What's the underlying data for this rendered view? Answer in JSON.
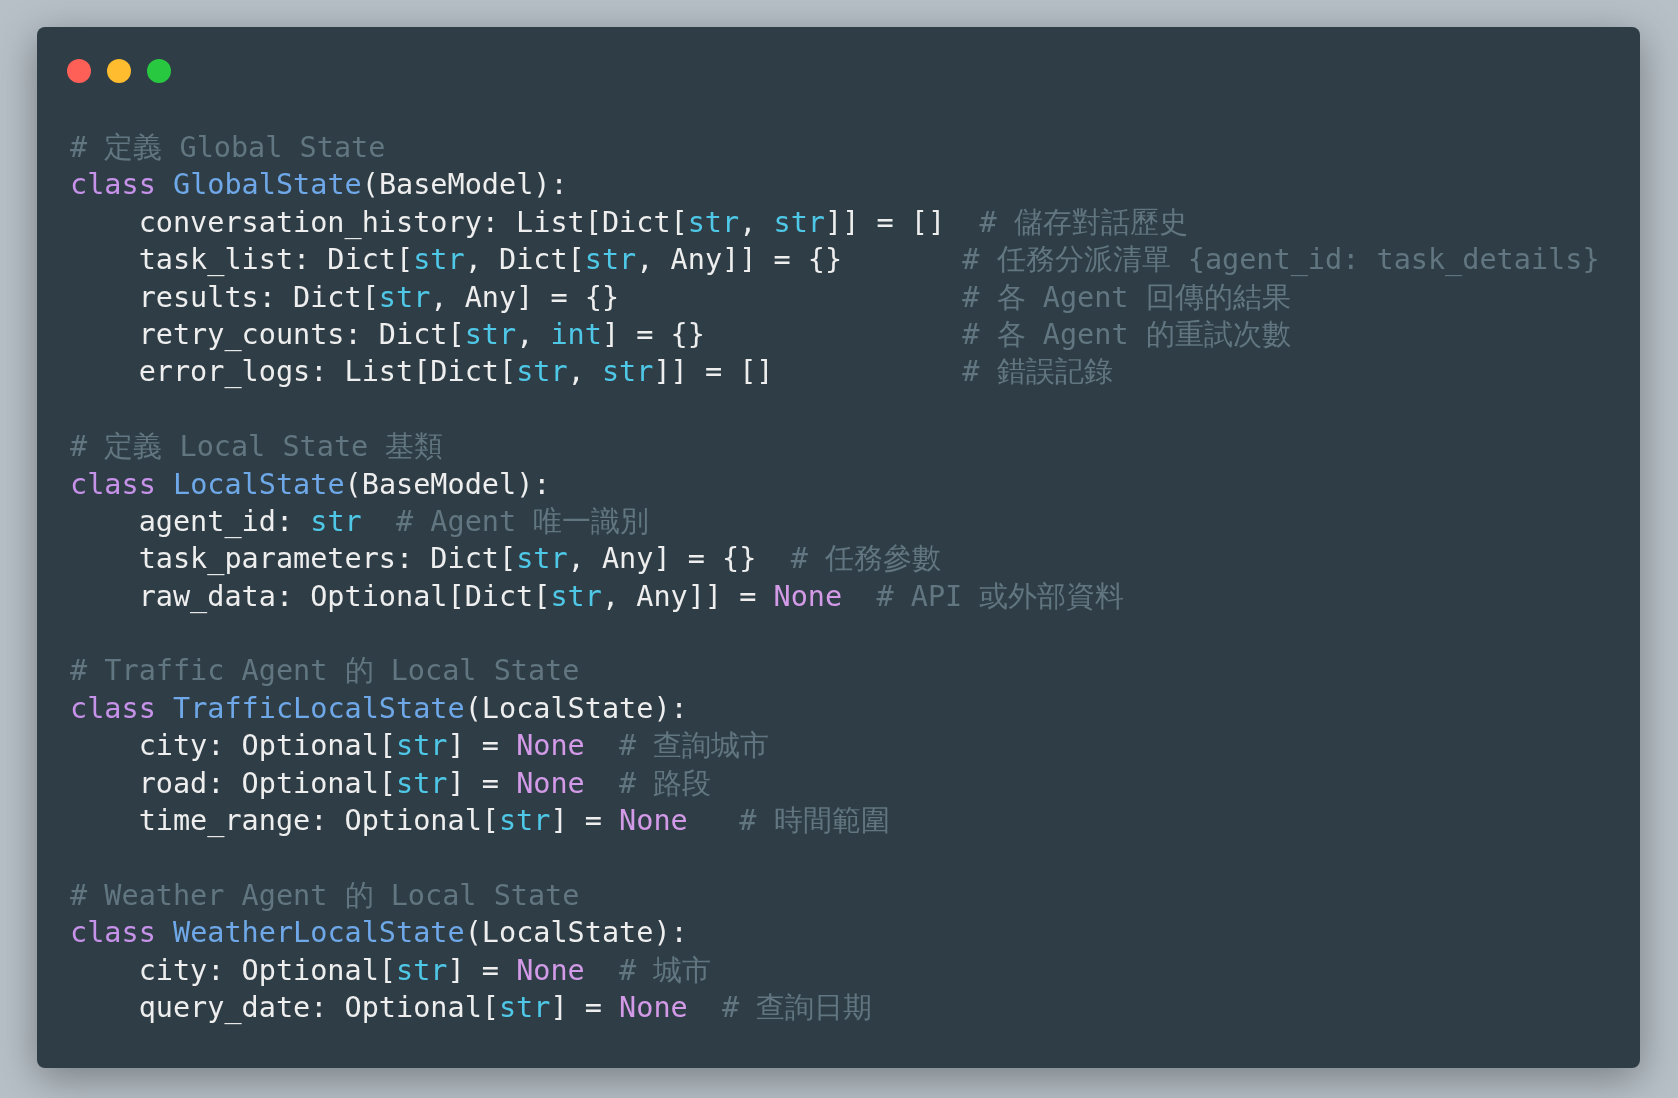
{
  "window": {
    "controls": [
      {
        "color": "#fe5f57"
      },
      {
        "color": "#febc2e"
      },
      {
        "color": "#28c840"
      }
    ]
  },
  "blocks": [
    {
      "comment": "# 定義 Global State",
      "header": [
        {
          "kind": "keyword",
          "text": "class"
        },
        {
          "kind": "classname",
          "text": " GlobalState"
        },
        {
          "kind": "plain",
          "text": "(BaseModel):"
        }
      ],
      "fields": [
        [
          {
            "kind": "plain",
            "text": "conversation_history: List[Dict["
          },
          {
            "kind": "type",
            "text": "str"
          },
          {
            "kind": "plain",
            "text": ", "
          },
          {
            "kind": "type",
            "text": "str"
          },
          {
            "kind": "plain",
            "text": "]] = []"
          },
          {
            "kind": "comment",
            "text": "  # 儲存對話歷史"
          }
        ],
        [
          {
            "kind": "plain",
            "text": "task_list: Dict["
          },
          {
            "kind": "type",
            "text": "str"
          },
          {
            "kind": "plain",
            "text": ", Dict["
          },
          {
            "kind": "type",
            "text": "str"
          },
          {
            "kind": "plain",
            "text": ", Any]] = {}"
          },
          {
            "kind": "comment",
            "text": "       # 任務分派清單 {agent_id: task_details}"
          }
        ],
        [
          {
            "kind": "plain",
            "text": "results: Dict["
          },
          {
            "kind": "type",
            "text": "str"
          },
          {
            "kind": "plain",
            "text": ", Any] = {}"
          },
          {
            "kind": "comment",
            "text": "                    # 各 Agent 回傳的結果"
          }
        ],
        [
          {
            "kind": "plain",
            "text": "retry_counts: Dict["
          },
          {
            "kind": "type",
            "text": "str"
          },
          {
            "kind": "plain",
            "text": ", "
          },
          {
            "kind": "type",
            "text": "int"
          },
          {
            "kind": "plain",
            "text": "] = {}"
          },
          {
            "kind": "comment",
            "text": "               # 各 Agent 的重試次數"
          }
        ],
        [
          {
            "kind": "plain",
            "text": "error_logs: List[Dict["
          },
          {
            "kind": "type",
            "text": "str"
          },
          {
            "kind": "plain",
            "text": ", "
          },
          {
            "kind": "type",
            "text": "str"
          },
          {
            "kind": "plain",
            "text": "]] = []"
          },
          {
            "kind": "comment",
            "text": "           # 錯誤記錄"
          }
        ]
      ]
    },
    {
      "comment": "# 定義 Local State 基類",
      "header": [
        {
          "kind": "keyword",
          "text": "class"
        },
        {
          "kind": "classname",
          "text": " LocalState"
        },
        {
          "kind": "plain",
          "text": "(BaseModel):"
        }
      ],
      "fields": [
        [
          {
            "kind": "plain",
            "text": "agent_id: "
          },
          {
            "kind": "type",
            "text": "str"
          },
          {
            "kind": "comment",
            "text": "  # Agent 唯一識別"
          }
        ],
        [
          {
            "kind": "plain",
            "text": "task_parameters: Dict["
          },
          {
            "kind": "type",
            "text": "str"
          },
          {
            "kind": "plain",
            "text": ", Any] = {}"
          },
          {
            "kind": "comment",
            "text": "  # 任務參數"
          }
        ],
        [
          {
            "kind": "plain",
            "text": "raw_data: Optional[Dict["
          },
          {
            "kind": "type",
            "text": "str"
          },
          {
            "kind": "plain",
            "text": ", Any]] = "
          },
          {
            "kind": "constant",
            "text": "None"
          },
          {
            "kind": "comment",
            "text": "  # API 或外部資料"
          }
        ]
      ]
    },
    {
      "comment": "# Traffic Agent 的 Local State",
      "header": [
        {
          "kind": "keyword",
          "text": "class"
        },
        {
          "kind": "classname",
          "text": " TrafficLocalState"
        },
        {
          "kind": "plain",
          "text": "(LocalState):"
        }
      ],
      "fields": [
        [
          {
            "kind": "plain",
            "text": "city: Optional["
          },
          {
            "kind": "type",
            "text": "str"
          },
          {
            "kind": "plain",
            "text": "] = "
          },
          {
            "kind": "constant",
            "text": "None"
          },
          {
            "kind": "comment",
            "text": "  # 查詢城市"
          }
        ],
        [
          {
            "kind": "plain",
            "text": "road: Optional["
          },
          {
            "kind": "type",
            "text": "str"
          },
          {
            "kind": "plain",
            "text": "] = "
          },
          {
            "kind": "constant",
            "text": "None"
          },
          {
            "kind": "comment",
            "text": "  # 路段"
          }
        ],
        [
          {
            "kind": "plain",
            "text": "time_range: Optional["
          },
          {
            "kind": "type",
            "text": "str"
          },
          {
            "kind": "plain",
            "text": "] = "
          },
          {
            "kind": "constant",
            "text": "None"
          },
          {
            "kind": "comment",
            "text": "   # 時間範圍"
          }
        ]
      ]
    },
    {
      "comment": "# Weather Agent 的 Local State",
      "header": [
        {
          "kind": "keyword",
          "text": "class"
        },
        {
          "kind": "classname",
          "text": " WeatherLocalState"
        },
        {
          "kind": "plain",
          "text": "(LocalState):"
        }
      ],
      "fields": [
        [
          {
            "kind": "plain",
            "text": "city: Optional["
          },
          {
            "kind": "type",
            "text": "str"
          },
          {
            "kind": "plain",
            "text": "] = "
          },
          {
            "kind": "constant",
            "text": "None"
          },
          {
            "kind": "comment",
            "text": "  # 城市"
          }
        ],
        [
          {
            "kind": "plain",
            "text": "query_date: Optional["
          },
          {
            "kind": "type",
            "text": "str"
          },
          {
            "kind": "plain",
            "text": "] = "
          },
          {
            "kind": "constant",
            "text": "None"
          },
          {
            "kind": "comment",
            "text": "  # 查詢日期"
          }
        ]
      ]
    }
  ]
}
